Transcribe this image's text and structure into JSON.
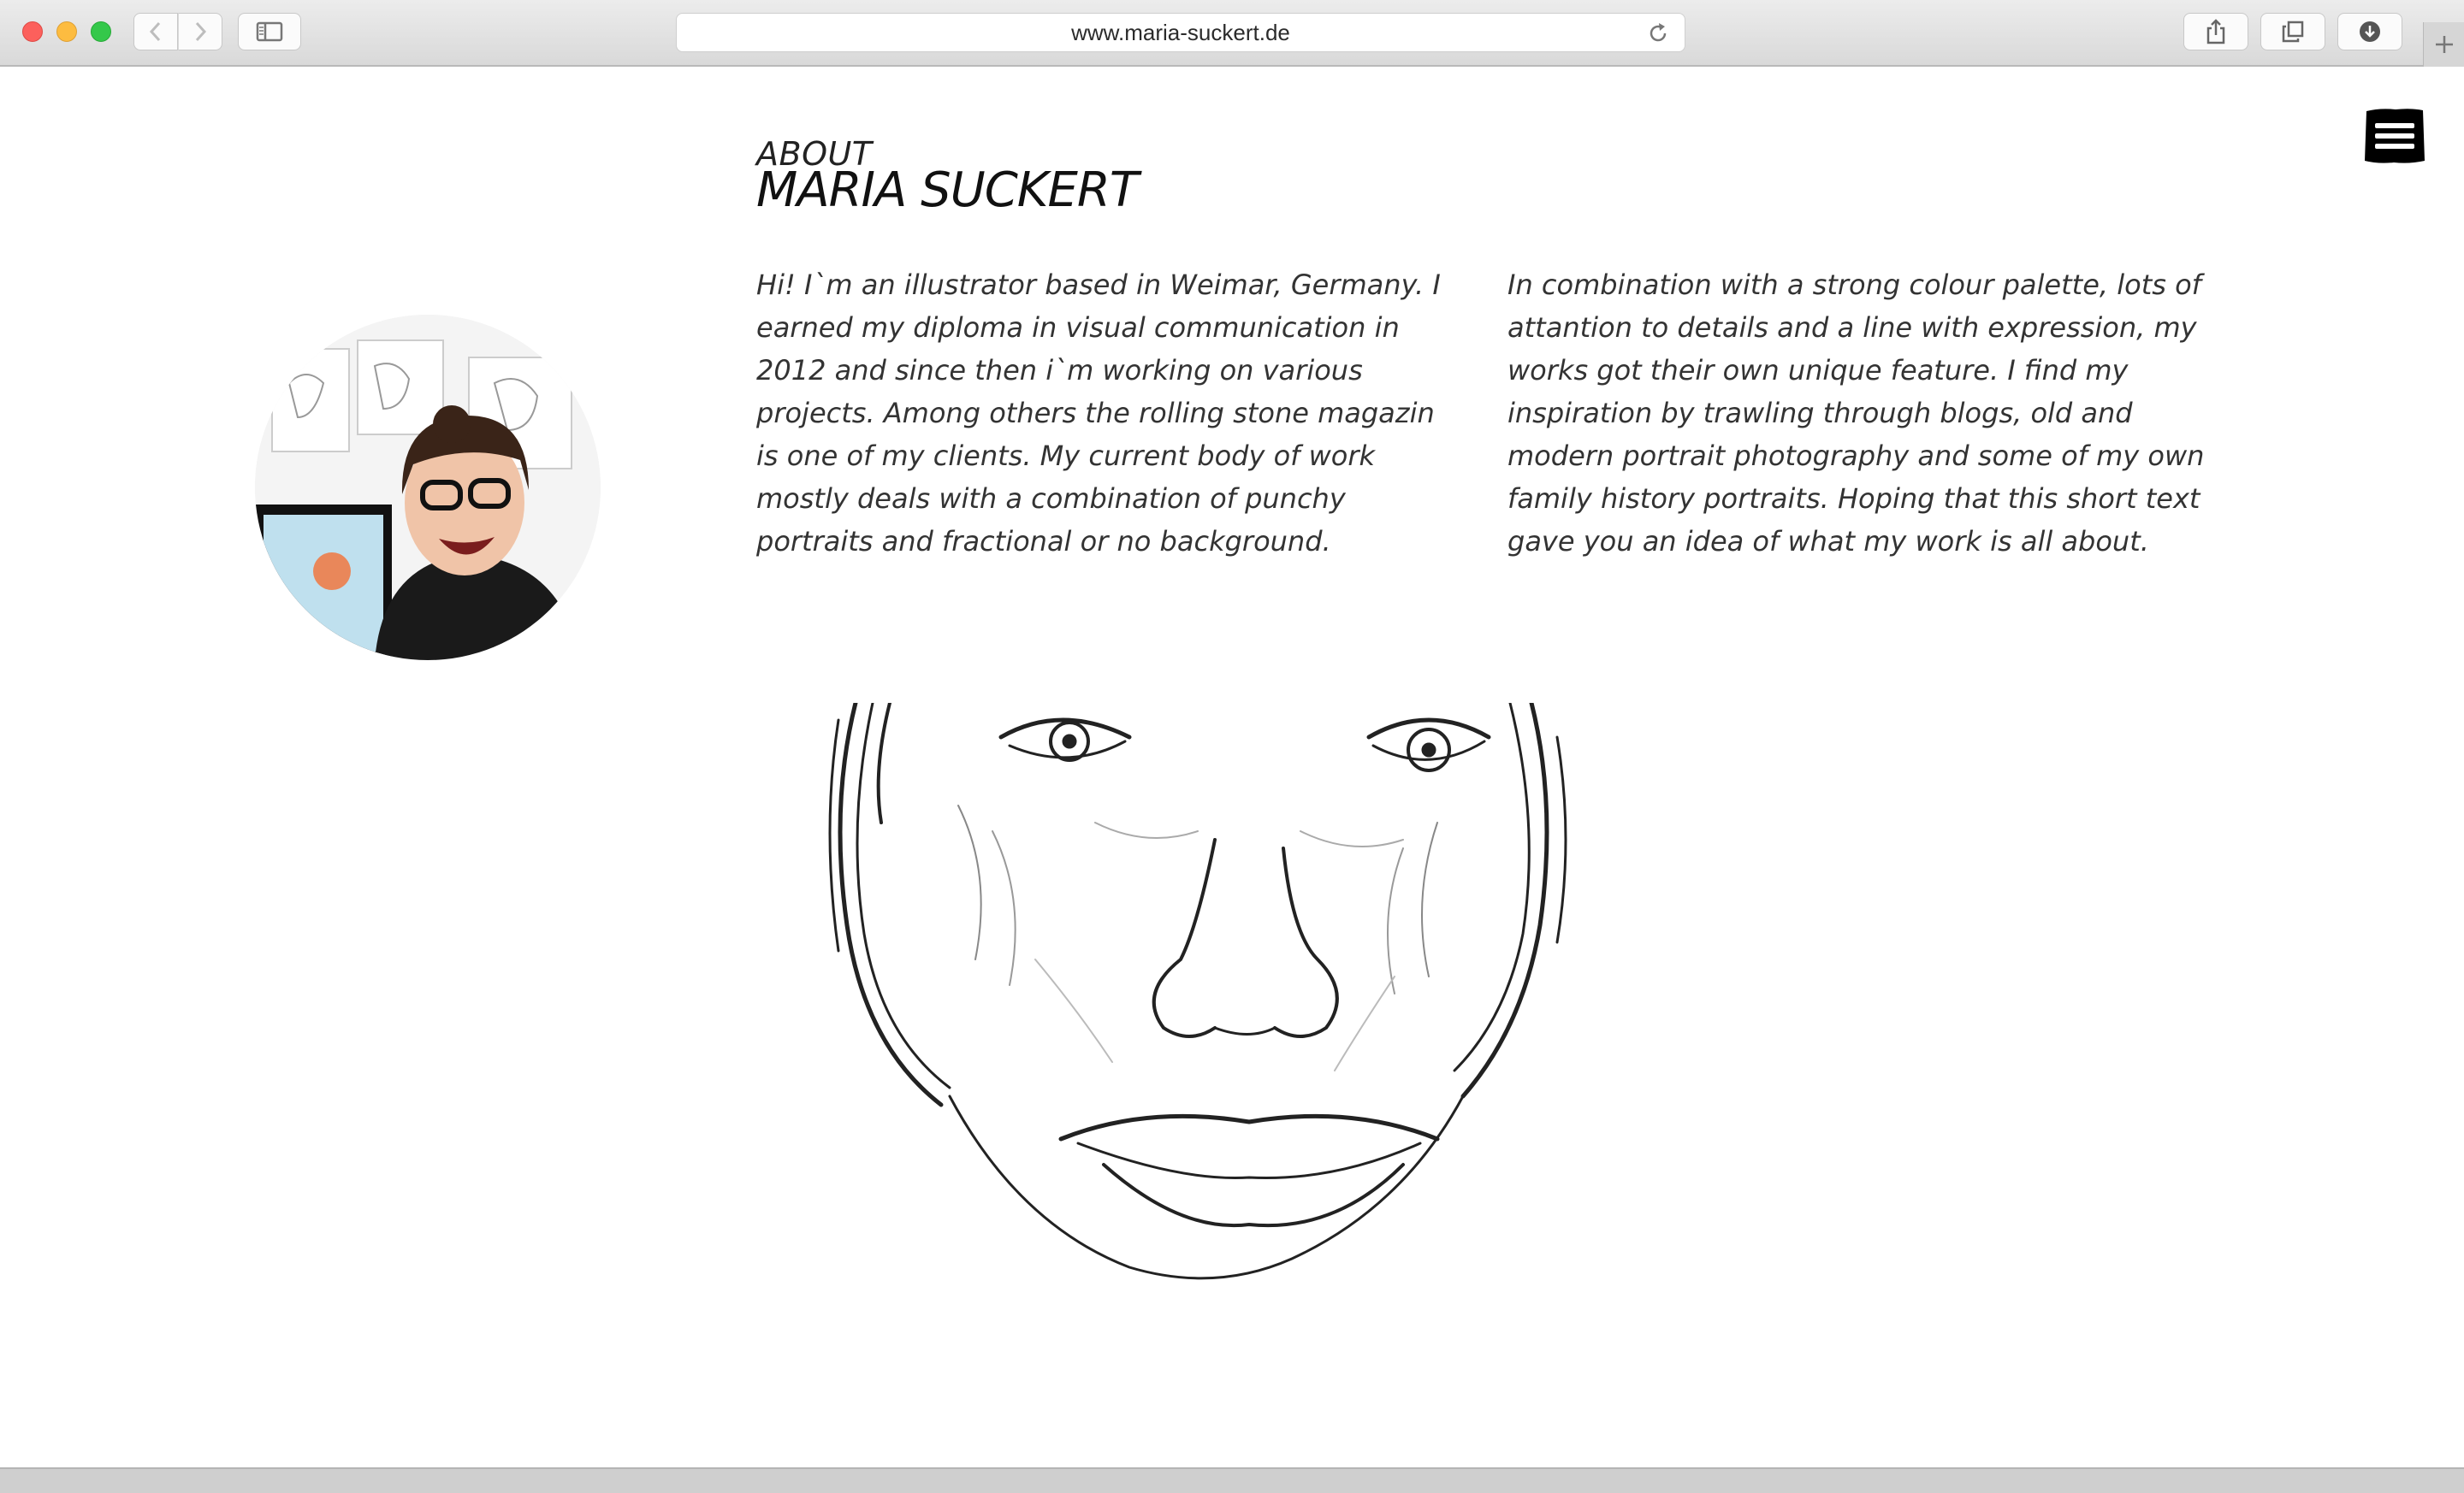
{
  "browser": {
    "url": "www.maria-suckert.de"
  },
  "page": {
    "heading_small": "ABOUT",
    "heading_big": "MARIA SUCKERT",
    "column_left": "Hi! I`m an illustrator based in Weimar, Germany. I earned my diploma in visual communication in 2012 and since then i`m working on various projects. Among others the rolling stone magazin is one of my clients. My current body of work mostly deals with a combination of punchy portraits and fractional or no background.",
    "column_right": "In combination with a strong colour palette, lots of attantion to details and a line with expression, my works got their own unique feature. I find my inspiration by trawling through blogs, old and modern portrait photography and some of my own family history portraits. Hoping that this short text gave you an idea of what my work is all about."
  },
  "icons": {
    "menu": "hamburger-menu-icon",
    "back": "chevron-left-icon",
    "forward": "chevron-right-icon",
    "sidebar": "sidebar-icon",
    "reload": "reload-icon",
    "share": "share-icon",
    "tabs": "tabs-icon",
    "download": "download-icon",
    "new_tab": "plus-icon"
  },
  "colors": {
    "traffic_red": "#fc605c",
    "traffic_yellow": "#fdbc40",
    "traffic_green": "#34c84a",
    "menu_bg": "#000000"
  }
}
